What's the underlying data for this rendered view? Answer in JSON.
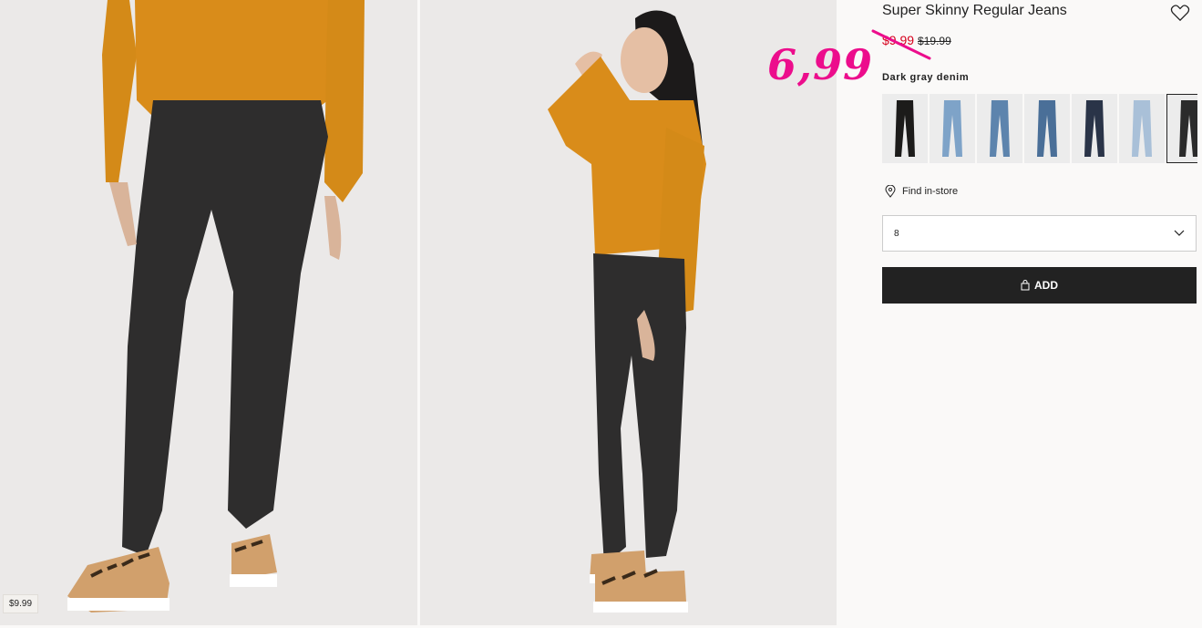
{
  "product": {
    "title": "Super Skinny Regular Jeans",
    "sale_price": "$9.99",
    "original_price": "$19.99",
    "color_name": "Dark gray denim",
    "handwritten_price": "6,99"
  },
  "gallery": {
    "price_tag": "$9.99"
  },
  "swatches": [
    {
      "color": "#1c1b1a",
      "selected": false
    },
    {
      "color": "#7ea3c8",
      "selected": false
    },
    {
      "color": "#5d84ad",
      "selected": false
    },
    {
      "color": "#4a6f98",
      "selected": false
    },
    {
      "color": "#2a3448",
      "selected": false
    },
    {
      "color": "#a9c0d8",
      "selected": false
    },
    {
      "color": "#2b2b2b",
      "selected": true
    }
  ],
  "actions": {
    "find_in_store": "Find in-store",
    "size_value": "8",
    "add_label": "ADD"
  },
  "colors": {
    "accent_pink": "#ec0d8c",
    "sale_red": "#d6001c",
    "button_dark": "#222222"
  }
}
